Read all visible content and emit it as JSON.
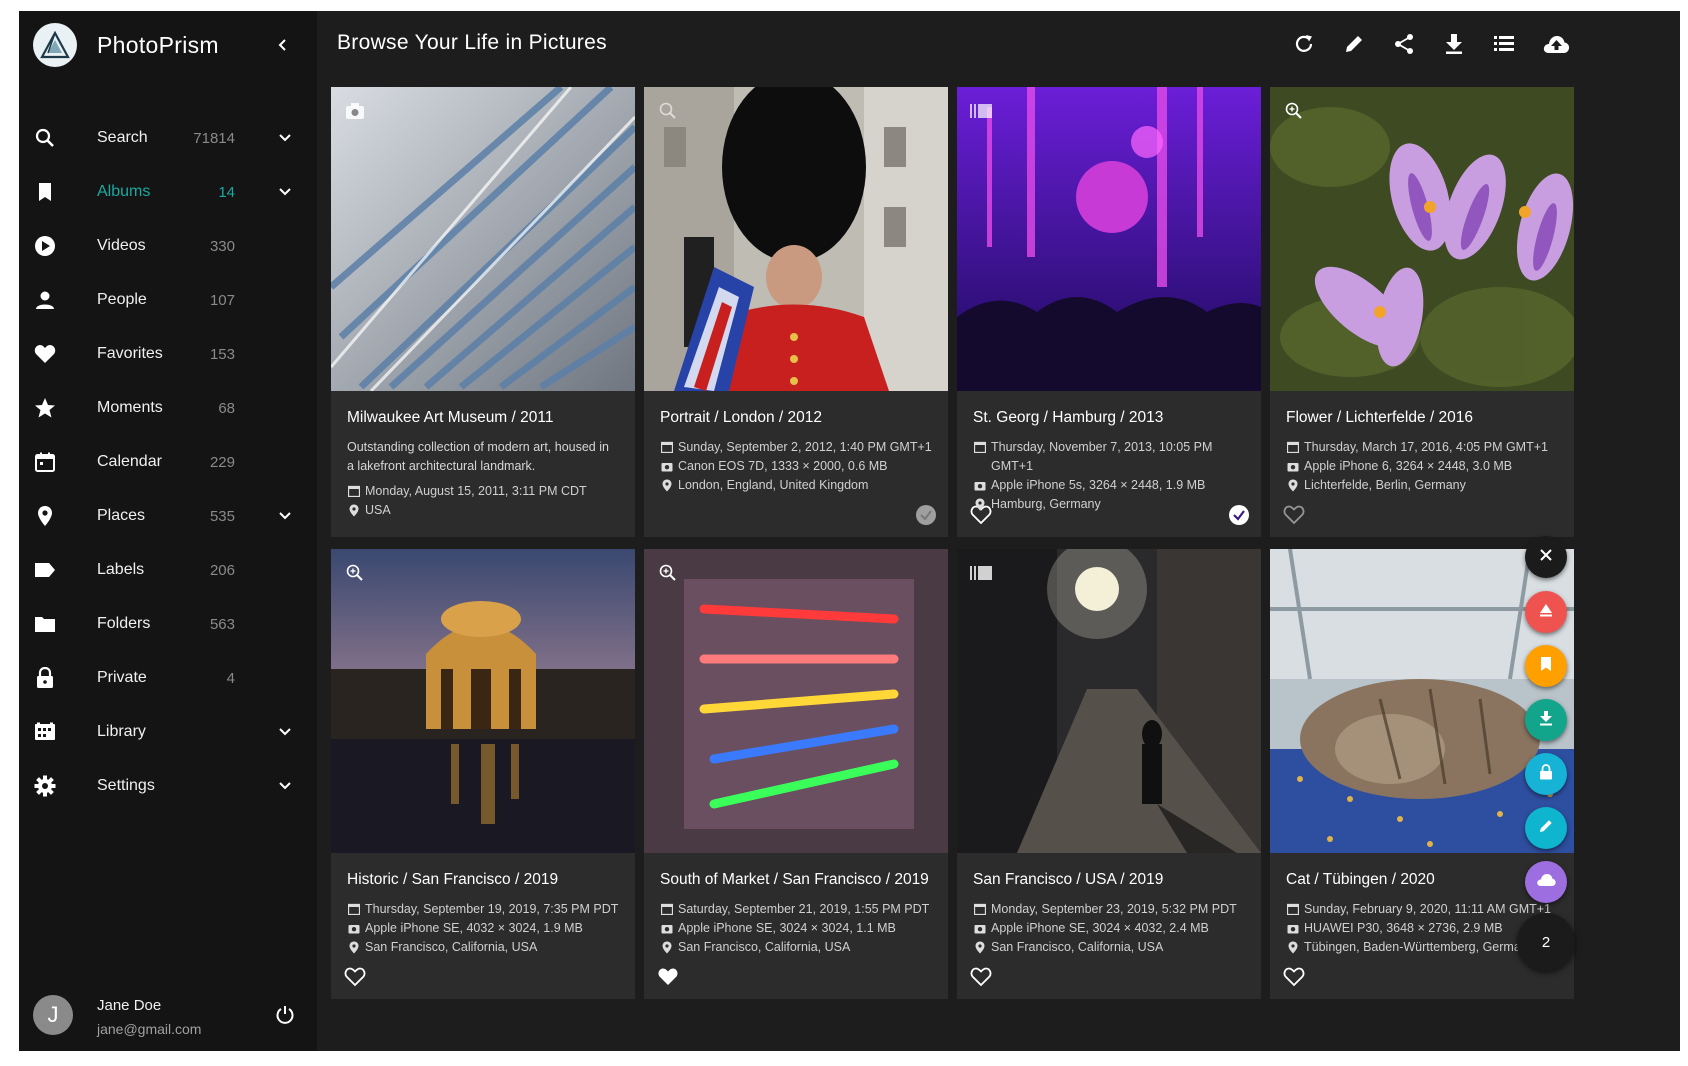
{
  "app": {
    "name": "PhotoPrism",
    "page_title": "Browse Your Life in Pictures"
  },
  "colors": {
    "accent": "#19a9a0",
    "sidebar_bg": "#141414",
    "main_bg": "#1d1d1d",
    "card_bg": "#2c2c2c"
  },
  "sidebar": {
    "items": [
      {
        "label": "Search",
        "count": "71814",
        "icon": "search-icon",
        "expandable": true
      },
      {
        "label": "Albums",
        "count": "14",
        "icon": "bookmark-icon",
        "expandable": true,
        "active": true
      },
      {
        "label": "Videos",
        "count": "330",
        "icon": "play-circle-icon"
      },
      {
        "label": "People",
        "count": "107",
        "icon": "person-icon"
      },
      {
        "label": "Favorites",
        "count": "153",
        "icon": "heart-icon"
      },
      {
        "label": "Moments",
        "count": "68",
        "icon": "star-icon"
      },
      {
        "label": "Calendar",
        "count": "229",
        "icon": "calendar-icon"
      },
      {
        "label": "Places",
        "count": "535",
        "icon": "place-pin-icon",
        "expandable": true
      },
      {
        "label": "Labels",
        "count": "206",
        "icon": "label-icon"
      },
      {
        "label": "Folders",
        "count": "563",
        "icon": "folder-icon"
      },
      {
        "label": "Private",
        "count": "4",
        "icon": "lock-icon"
      },
      {
        "label": "Library",
        "count": "",
        "icon": "library-icon",
        "expandable": true
      },
      {
        "label": "Settings",
        "count": "",
        "icon": "gear-icon",
        "expandable": true
      }
    ]
  },
  "user": {
    "initial": "J",
    "name": "Jane Doe",
    "email": "jane@gmail.com"
  },
  "toolbar_icons": [
    "refresh-icon",
    "edit-icon",
    "share-icon",
    "download-icon",
    "list-view-icon",
    "upload-icon"
  ],
  "cards": [
    {
      "title": "Milwaukee Art Museum / 2011",
      "description": "Outstanding collection of modern art, housed in a lakefront architectural landmark.",
      "date": "Monday, August 15, 2011, 3:11 PM CDT",
      "camera": "",
      "location": "USA",
      "top_icon": "camera-icon",
      "heart": false,
      "selected": false
    },
    {
      "title": "Portrait / London / 2012",
      "description": "",
      "date": "Sunday, September 2, 2012, 1:40 PM GMT+1",
      "camera": "Canon EOS 7D, 1333 × 2000, 0.6 MB",
      "location": "London, England, United Kingdom",
      "top_icon": "zoom-icon",
      "heart": false,
      "selected": true
    },
    {
      "title": "St. Georg / Hamburg / 2013",
      "description": "",
      "date": "Thursday, November 7, 2013, 10:05 PM GMT+1",
      "camera": "Apple iPhone 5s, 3264 × 2448, 1.9 MB",
      "location": "Hamburg, Germany",
      "top_icon": "burst-icon",
      "heart": false,
      "selected": true
    },
    {
      "title": "Flower / Lichterfelde / 2016",
      "description": "",
      "date": "Thursday, March 17, 2016, 4:05 PM GMT+1",
      "camera": "Apple iPhone 6, 3264 × 2448, 3.0 MB",
      "location": "Lichterfelde, Berlin, Germany",
      "top_icon": "zoom-icon",
      "heart": false,
      "selected": false
    },
    {
      "title": "Historic / San Francisco / 2019",
      "description": "",
      "date": "Thursday, September 19, 2019, 7:35 PM PDT",
      "camera": "Apple iPhone SE, 4032 × 3024, 1.9 MB",
      "location": "San Francisco, California, USA",
      "top_icon": "zoom-icon",
      "heart": false,
      "selected": false
    },
    {
      "title": "South of Market / San Francisco / 2019",
      "description": "",
      "date": "Saturday, September 21, 2019, 1:55 PM PDT",
      "camera": "Apple iPhone SE, 3024 × 3024, 1.1 MB",
      "location": "San Francisco, California, USA",
      "top_icon": "zoom-icon",
      "heart": true,
      "selected": false
    },
    {
      "title": "San Francisco / USA / 2019",
      "description": "",
      "date": "Monday, September 23, 2019, 5:32 PM PDT",
      "camera": "Apple iPhone SE, 3024 × 4032, 2.4 MB",
      "location": "San Francisco, California, USA",
      "top_icon": "burst-icon",
      "heart": false,
      "selected": false
    },
    {
      "title": "Cat / Tübingen / 2020",
      "description": "",
      "date": "Sunday, February 9, 2020, 11:11 AM GMT+1",
      "camera": "HUAWEI P30, 3648 × 2736, 2.9 MB",
      "location": "Tübingen, Baden-Württemberg, Germa",
      "top_icon": "",
      "heart": false,
      "selected": false
    }
  ],
  "speed_dial": {
    "selection_count": "2",
    "actions": [
      {
        "name": "close-icon",
        "color": "#1b1b1b"
      },
      {
        "name": "share-upload-icon",
        "color": "#ef5350"
      },
      {
        "name": "bookmark-icon",
        "color": "#ffa000"
      },
      {
        "name": "download-icon",
        "color": "#12a58c"
      },
      {
        "name": "lock-icon",
        "color": "#16b3d6"
      },
      {
        "name": "edit-icon",
        "color": "#0fb5cf"
      },
      {
        "name": "cloud-icon",
        "color": "#9c6ee0"
      }
    ]
  }
}
